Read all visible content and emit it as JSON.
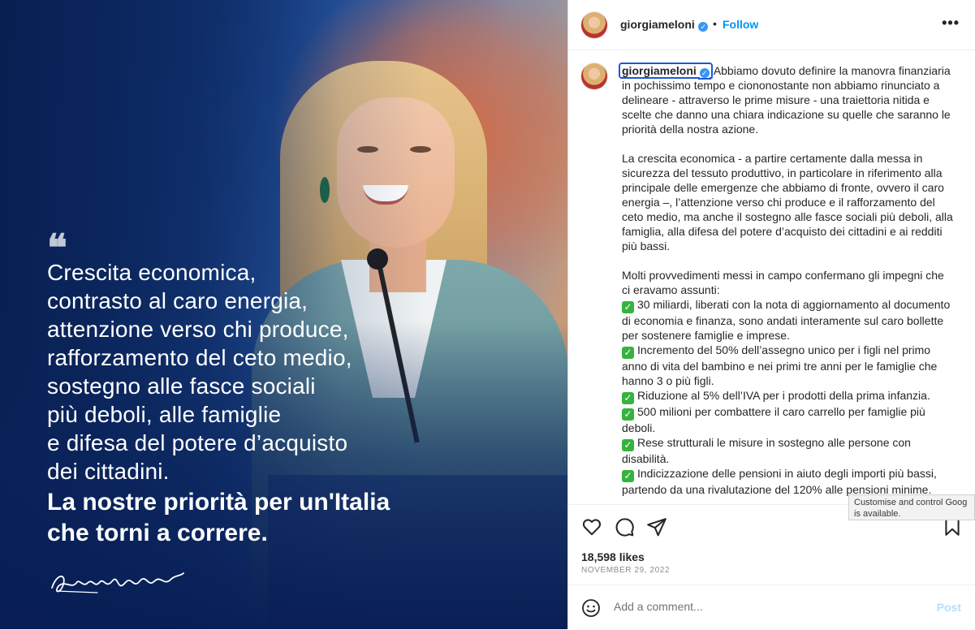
{
  "media": {
    "quote_mark": "❝",
    "quote_lines": [
      "Crescita economica,",
      "contrasto al caro energia,",
      "attenzione verso chi produce,",
      "rafforzamento del ceto medio,",
      "sostegno alle fasce sociali",
      "più deboli, alle famiglie",
      "e difesa del potere d’acquisto",
      "dei cittadini."
    ],
    "bold_lines": [
      "La nostre priorità per un'Italia",
      "che torni a correre."
    ],
    "signature": "Giorgia Meloni"
  },
  "header": {
    "username": "giorgiameloni",
    "separator": "•",
    "follow_label": "Follow",
    "more_label": "•••"
  },
  "caption": {
    "username": "giorgiameloni",
    "intro": "Abbiamo dovuto definire la manovra finanziaria in pochissimo tempo e ciononostante non abbiamo rinunciato a delineare - attraverso le prime misure - una traiettoria nitida e scelte che danno una chiara indicazione su quelle che saranno le priorità della nostra azione.",
    "paragraph2": "La crescita economica - a partire certamente dalla messa in sicurezza del tessuto produttivo, in particolare in riferimento alla principale delle emergenze che abbiamo di fronte, ovvero il caro energia –, l’attenzione verso chi produce e il rafforzamento del ceto medio, ma anche il sostegno alle fasce sociali più deboli, alla famiglia, alla difesa del potere d’acquisto dei cittadini e ai redditi più bassi.",
    "paragraph3": "Molti provvedimenti messi in campo confermano gli impegni che ci eravamo assunti:",
    "check_symbol": "✓",
    "items": [
      "30 miliardi, liberati con la nota di aggiornamento al documento di economia e finanza, sono andati interamente sul caro bollette per sostenere famiglie e imprese.",
      "Incremento del 50% dell’assegno unico per i figli nel primo anno di vita del bambino e nei primi tre anni per le famiglie che hanno 3 o più figli.",
      "Riduzione al 5% dell’IVA per i prodotti della prima infanzia.",
      "500 milioni per combattere il caro carrello per famiglie più deboli.",
      "Rese strutturali le misure in sostegno alle persone con disabilità.",
      "Indicizzazione delle pensioni in aiuto degli importi più bassi, partendo da una rivalutazione del 120% alle pensioni minime."
    ]
  },
  "actions": {
    "like_icon": "heart-icon",
    "comment_icon": "comment-icon",
    "share_icon": "paper-plane-icon",
    "save_icon": "bookmark-icon"
  },
  "stats": {
    "likes": "18,598 likes",
    "date": "NOVEMBER 29, 2022"
  },
  "comment": {
    "emoji_icon": "smiley-icon",
    "placeholder": "Add a comment...",
    "post_label": "Post"
  },
  "tooltip": {
    "line1": "Customise and control Goog",
    "line2": "is available."
  },
  "colors": {
    "link_blue": "#0095f6",
    "verified_blue": "#3897f0",
    "check_green": "#35b33d",
    "post_disabled": "#b2dffc"
  }
}
